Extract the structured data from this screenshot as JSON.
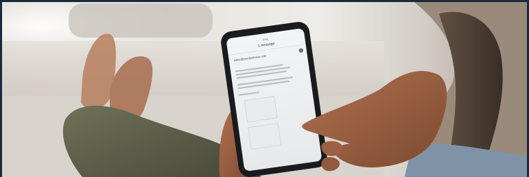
{
  "photo": {
    "phone_screen": {
      "status_time": "9:41",
      "header_title": "1 message",
      "header_subtitle": "",
      "sender_email": "sales@yourbusiness.com",
      "sender_sub": "",
      "body_lines": [],
      "signature": ""
    }
  }
}
